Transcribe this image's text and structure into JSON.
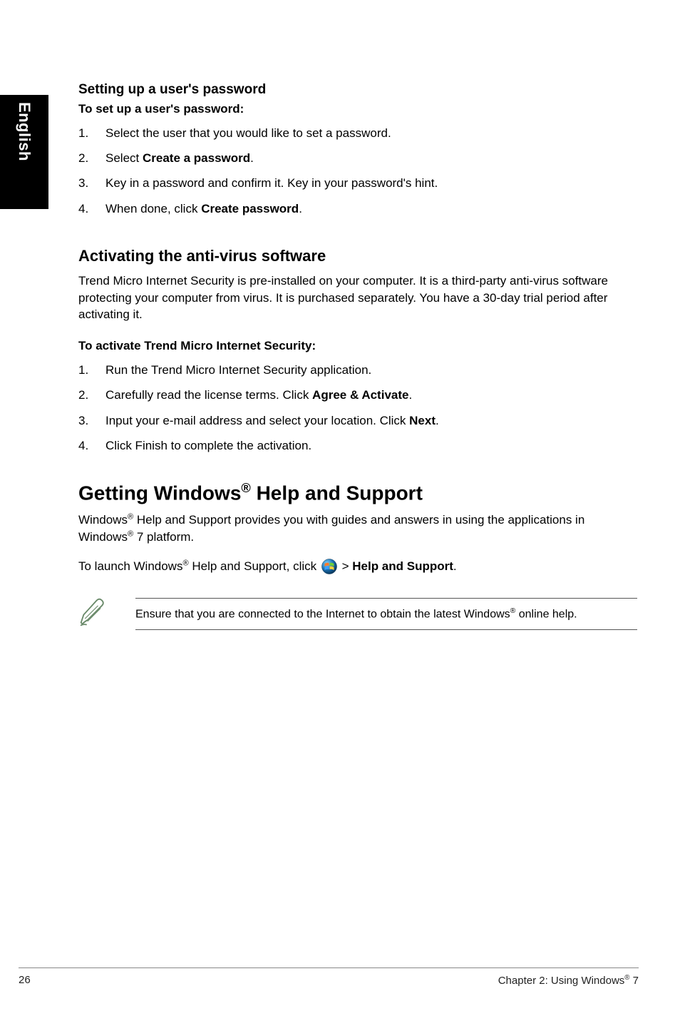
{
  "side_tab": "English",
  "section1": {
    "heading": "Setting up a user's password",
    "subheading": "To set up a user's password:",
    "items": [
      {
        "num": "1.",
        "text": "Select the user that you would like to set a password."
      },
      {
        "num": "2.",
        "pre": "Select ",
        "bold": "Create a password",
        "post": "."
      },
      {
        "num": "3.",
        "text": "Key in a password and confirm it. Key in your password's hint."
      },
      {
        "num": "4.",
        "pre": "When done, click ",
        "bold": "Create password",
        "post": "."
      }
    ]
  },
  "section2": {
    "heading": "Activating the anti-virus software",
    "para": "Trend Micro Internet Security is pre-installed on your computer. It is a third-party anti-virus software protecting your computer from virus. It is purchased separately. You have a 30-day trial period after activating it.",
    "subheading": "To activate Trend Micro Internet Security:",
    "items": [
      {
        "num": "1.",
        "text": "Run the Trend Micro Internet Security application."
      },
      {
        "num": "2.",
        "pre": "Carefully read the license terms. Click ",
        "bold": "Agree & Activate",
        "post": "."
      },
      {
        "num": "3.",
        "pre": "Input your e-mail address and select your location. Click ",
        "bold": "Next",
        "post": "."
      },
      {
        "num": "4.",
        "text": "Click Finish to complete the activation."
      }
    ]
  },
  "section3": {
    "heading_pre": "Getting Windows",
    "heading_sup": "®",
    "heading_post": " Help and Support",
    "para_pre1": "Windows",
    "para_sup1": "®",
    "para_mid1": " Help and Support provides you with guides and answers in using the applications in Windows",
    "para_sup2": "®",
    "para_post1": " 7 platform.",
    "launch_pre": "To launch Windows",
    "launch_sup": "®",
    "launch_mid": " Help and Support, click ",
    "launch_gt": " > ",
    "launch_bold": "Help and Support",
    "launch_post": "."
  },
  "note": {
    "pre": "Ensure that you are connected to the Internet to obtain the latest Windows",
    "sup": "®",
    "post": " online help."
  },
  "footer": {
    "page": "26",
    "chapter_pre": "Chapter 2: Using Windows",
    "chapter_sup": "®",
    "chapter_post": " 7"
  }
}
